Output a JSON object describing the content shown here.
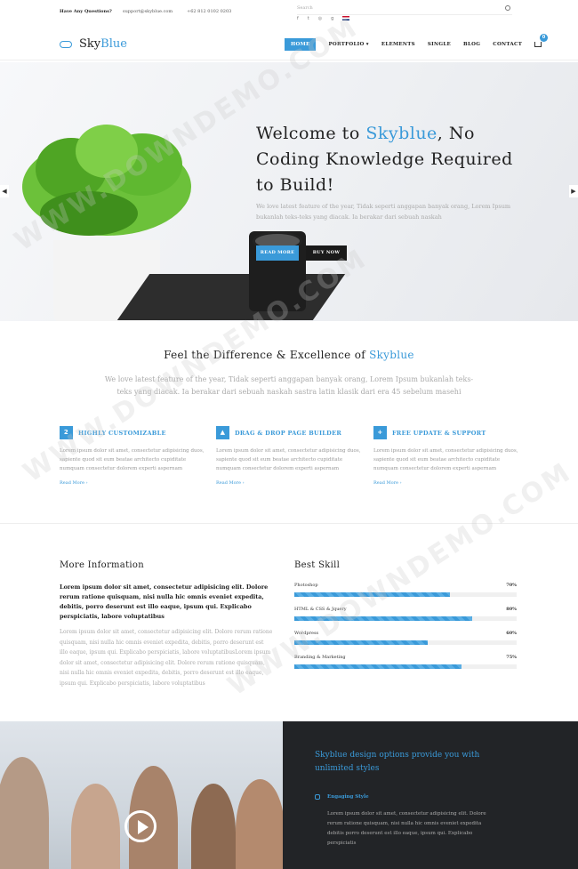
{
  "topbar": {
    "question": "Have Any Questions?",
    "email": "support@skyblue.com",
    "phone": "+62 812 0102 0203",
    "search_placeholder": "Search",
    "social_icons": [
      "facebook-icon",
      "twitter-icon",
      "instagram-icon",
      "google-plus-icon",
      "uk-flag-icon"
    ]
  },
  "header": {
    "logo_text_a": "Sky",
    "logo_text_b": "Blue",
    "nav": [
      "HOME",
      "PORTFOLIO ▾",
      "ELEMENTS",
      "SINGLE",
      "BLOG",
      "CONTACT"
    ],
    "cart_count": "0"
  },
  "hero": {
    "title_a": "Welcome to",
    "title_brand": "Skyblue",
    "title_b": ", No Coding Knowledge Required to Build!",
    "subtitle": "We love latest feature of the year, Tidak seperti anggapan banyak orang, Lorem Ipsum bukanlah teks-teks yang diacak. Ia berakar dari sebuah naskah",
    "btn_read": "READ MORE",
    "btn_buy": "BUY NOW"
  },
  "features": {
    "title_a": "Feel the Difference & Excellence of",
    "title_brand": "Skyblue",
    "subtitle": "We love latest feature of the year, Tidak seperti anggapan banyak orang, Lorem Ipsum bukanlah teks-teks yang diacak. Ia berakar dari sebuah naskah sastra latin klasik dari era 45 sebelum masehi",
    "items": [
      {
        "title": "HIGHLY CUSTOMIZABLE",
        "icon": "2",
        "text": "Lorem ipsum dolor sit amet, consectetur adipisicing duos, sapiente quod sit eum beatae architecto cupiditate numquam consectetur dolorem experti aspernam",
        "more": "Read More ›"
      },
      {
        "title": "DRAG & DROP PAGE BUILDER",
        "icon": "▲",
        "text": "Lorem ipsum dolor sit amet, consectetur adipisicing duos, sapiente quod sit eum beatae architecto cupiditate numquam consectetur dolorem experti aspernam",
        "more": "Read More ›"
      },
      {
        "title": "FREE UPDATE & SUPPORT",
        "icon": "+",
        "text": "Lorem ipsum dolor sit amet, consectetur adipisicing duos, sapiente quod sit eum beatae architecto cupiditate numquam consectetur dolorem experti aspernam",
        "more": "Read More ›"
      }
    ]
  },
  "info": {
    "title": "More Information",
    "bold": "Lorem ipsum dolor sit amet, consectetur adipisicing elit. Dolore rerum ratione quisquam, nisi nulla hic omnis eveniet expedita, debitis, porro deserunt est illo eaque, ipsum qui. Explicabo perspiciatis, labore voluptatibus",
    "body": "Lorem ipsum dolor sit amet, consectetur adipisicing elit. Dolore rerum ratione quisquam, nisi nulla hic omnis eveniet expedita, debitis, porro deserunt est illo eaque, ipsum qui. Explicabo perspiciatis, labore voluptatibusLorem ipsum dolor sit amet, consectetur adipisicing elit. Dolore rerum ratione quisquam, nisi nulla hic omnis eveniet expedita, debitis, porro deserunt est illo eaque, ipsum qui. Explicabo perspiciatis, labore voluptatibus"
  },
  "skills": {
    "title": "Best Skill",
    "items": [
      {
        "name": "Photoshop",
        "pct": "70%",
        "value": 0.7
      },
      {
        "name": "HTML & CSS & Jquery",
        "pct": "80%",
        "value": 0.8
      },
      {
        "name": "Wordpress",
        "pct": "60%",
        "value": 0.6
      },
      {
        "name": "Branding & Marketing",
        "pct": "75%",
        "value": 0.75
      }
    ]
  },
  "bottom": {
    "heading": "Skyblue design options provide you with unlimited styles",
    "style_label": "Engaging Style",
    "style_text": "Lorem ipsum dolor sit amet, consectetur adipisicing elit. Dolore rerum ratione quisquam, nisi nulla hic omnis eveniet expedita debitis porro deserunt est illo eaque, ipsum qui. Explicabo perspiciatis"
  },
  "colors": {
    "accent": "#3a9ad9",
    "dark": "#222427"
  }
}
